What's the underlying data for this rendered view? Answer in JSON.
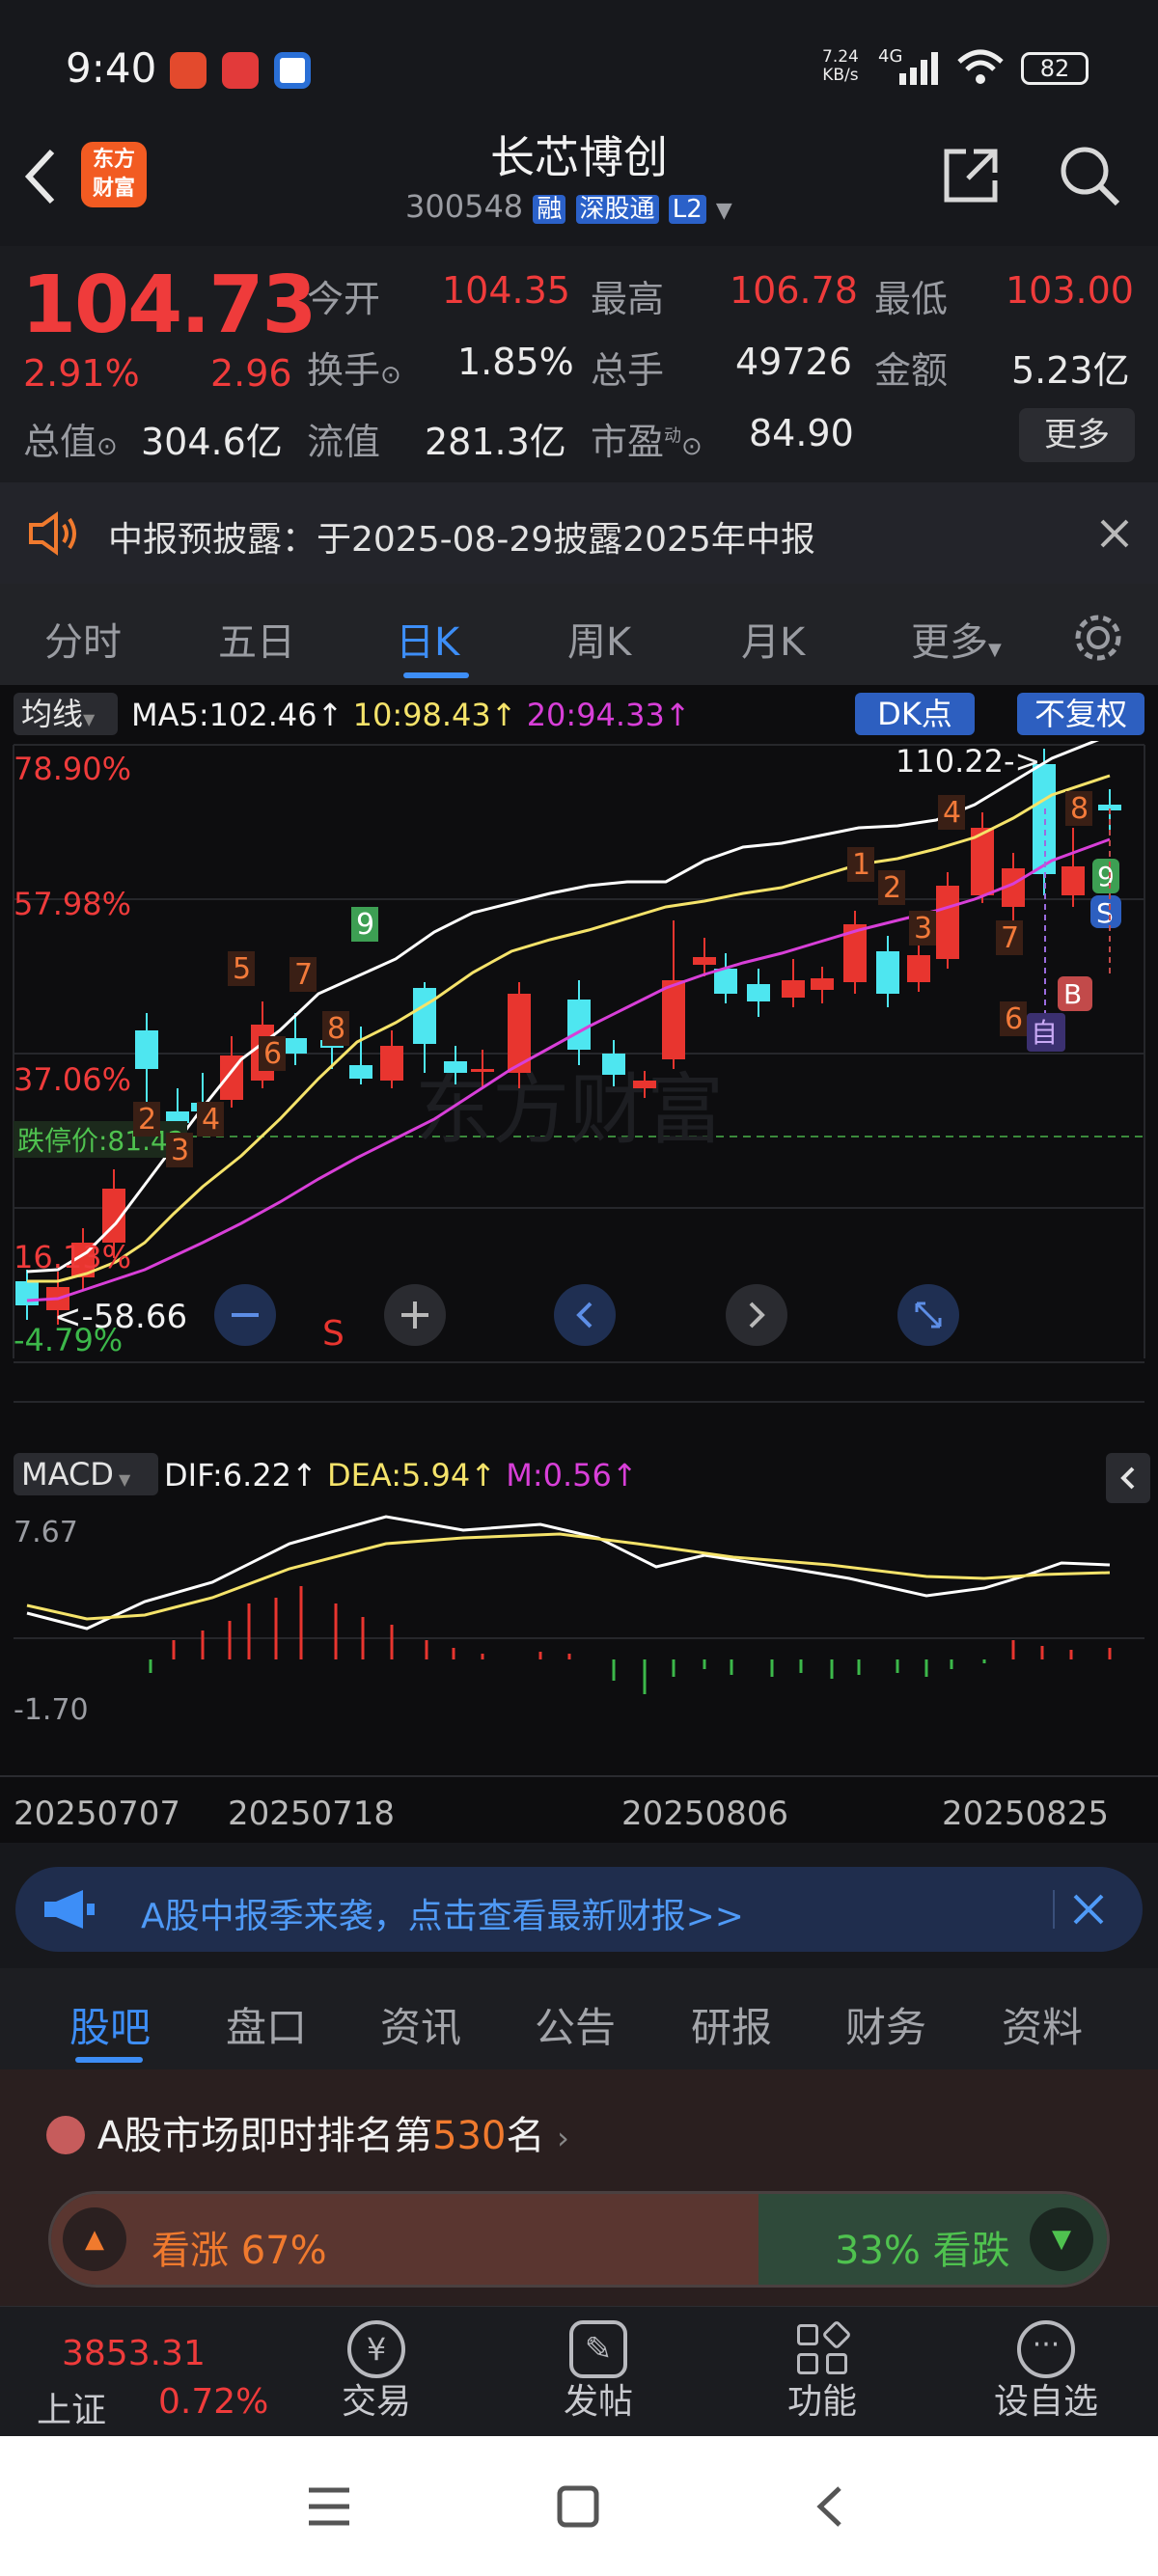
{
  "status_bar": {
    "time": "9:40",
    "net_speed_top": "7.24",
    "net_speed_bottom": "KB/s",
    "signal": "4G",
    "battery": "82",
    "icons": [
      "app-icon-red",
      "app-icon-gift",
      "app-icon-blue"
    ]
  },
  "header": {
    "logo_line1": "东方",
    "logo_line2": "财富",
    "stock_name": "长芯博创",
    "stock_code": "300548",
    "tag_rong": "融",
    "tag_connect": "深股通",
    "tag_level": "L2"
  },
  "quote": {
    "price": "104.73",
    "change_pct": "2.91%",
    "change_amt": "2.96",
    "fields": [
      {
        "label": "今开",
        "value": "104.35",
        "color": "#ef3b3b"
      },
      {
        "label": "最高",
        "value": "106.78",
        "color": "#ef3b3b"
      },
      {
        "label": "最低",
        "value": "103.00",
        "color": "#ef3b3b"
      },
      {
        "label": "换手",
        "value": "1.85%",
        "color": "#eaeaea"
      },
      {
        "label": "总手",
        "value": "49726",
        "color": "#eaeaea"
      },
      {
        "label": "金额",
        "value": "5.23亿",
        "color": "#eaeaea"
      },
      {
        "label": "总值",
        "value": "304.6亿",
        "color": "#eaeaea"
      },
      {
        "label": "流值",
        "value": "281.3亿",
        "color": "#eaeaea"
      },
      {
        "label": "市盈",
        "value": "84.90",
        "color": "#eaeaea"
      }
    ],
    "pe_sup": "动",
    "more_button": "更多"
  },
  "notice": {
    "text": "中报预披露：于2025-08-29披露2025年中报"
  },
  "period_tabs": {
    "items": [
      "分时",
      "五日",
      "日K",
      "周K",
      "月K",
      "更多"
    ],
    "active_index": 2
  },
  "chart_toolbar": {
    "indicator": "均线",
    "ma5": "MA5:102.46",
    "ma10": "10:98.43",
    "ma20": "20:94.33",
    "dk_button": "DK点",
    "fq_button": "不复权",
    "arrow": "↑"
  },
  "kline_labels": {
    "pct_top": "78.90%",
    "pct_2": "57.98%",
    "pct_3": "37.06%",
    "pct_4": "16.13%",
    "pct_bottom": "-4.79%",
    "limit_down": "跌停价:81.42",
    "high_label": "110.22->",
    "low_label": "<-58.66",
    "sell_mark": "S",
    "signal_b": "B",
    "signal_s": "S",
    "self_mark": "自",
    "watermark": "东方财富"
  },
  "macd": {
    "indicator": "MACD",
    "dif": "DIF:6.22",
    "dea": "DEA:5.94",
    "m": "M:0.56",
    "top": "7.67",
    "bottom": "-1.70"
  },
  "xaxis": {
    "dates": [
      "20250707",
      "20250718",
      "20250806",
      "20250825"
    ]
  },
  "chart_data": {
    "type": "candlestick",
    "ylabels_pct": [
      "78.90%",
      "57.98%",
      "37.06%",
      "16.13%",
      "-4.79%"
    ],
    "ma": {
      "ma5": 102.46,
      "ma10": 98.43,
      "ma20": 94.33
    },
    "macd": {
      "dif": 6.22,
      "dea": 5.94,
      "m": 0.56,
      "range": [
        -1.7,
        7.67
      ]
    },
    "high": 110.22,
    "low": 58.66,
    "limit_down": 81.42,
    "x_labels": [
      "20250707",
      "20250718",
      "20250806",
      "20250825"
    ],
    "colors": {
      "up": "#e8352f",
      "down": "#4ee6f0",
      "ma5": "#ffffff",
      "ma10": "#f5e36a",
      "ma20": "#d83fd8",
      "dif": "#ffffff",
      "dea": "#f5e36a"
    }
  },
  "ad_banner": {
    "text": "A股中报季来袭，点击查看最新财报>>"
  },
  "bottom_tabs": {
    "items": [
      "股吧",
      "盘口",
      "资讯",
      "公告",
      "研报",
      "财务",
      "资料"
    ],
    "active_index": 0
  },
  "ranking": {
    "prefix": "A股市场即时排名第",
    "rank": "530",
    "suffix": "名",
    "bull": "看涨 67%",
    "bear": "33% 看跌",
    "bull_pct": 67
  },
  "bottom_nav": {
    "index_value": "3853.31",
    "index_name": "上证",
    "index_change": "0.72%",
    "items": [
      "交易",
      "发帖",
      "功能",
      "设自选"
    ]
  }
}
